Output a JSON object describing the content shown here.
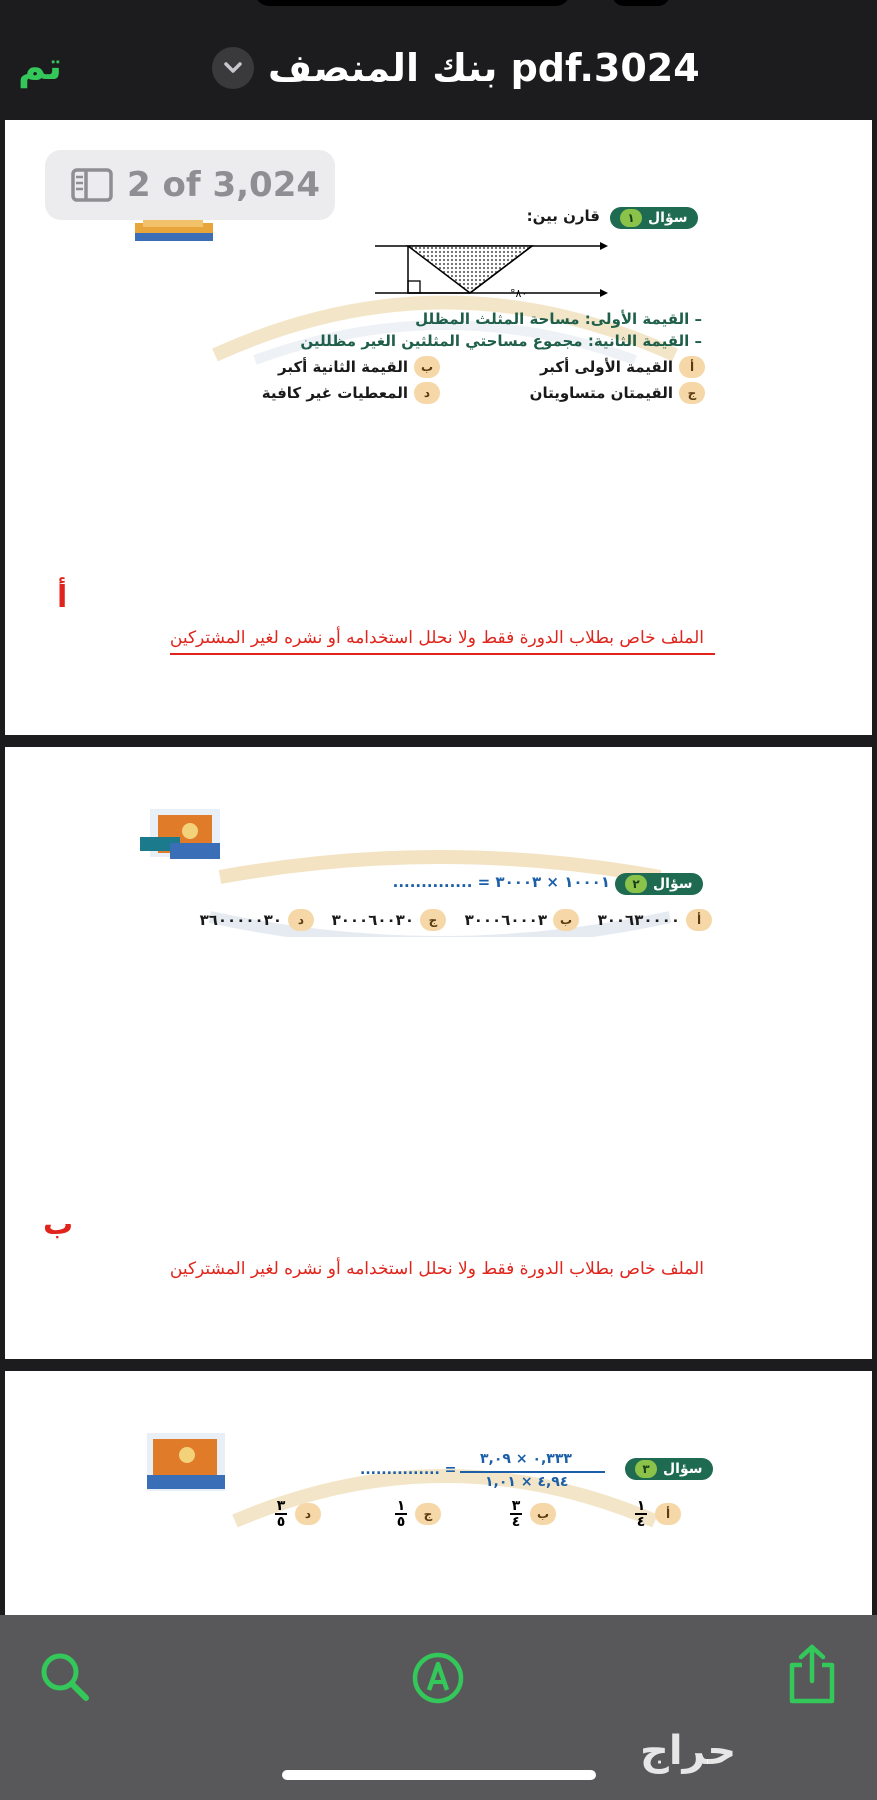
{
  "header": {
    "done_label": "تم",
    "title": "بنك المنصف pdf.3024"
  },
  "page_counter": "2 of 3,024",
  "pages": [
    {
      "question_label": "سؤال",
      "question_number": "١",
      "prompt": "قارن بين:",
      "angle_label": "٨٠°",
      "value1": "– القيمة الأولى: مساحة المثلث المظلل",
      "value2": "– القيمة الثانية: مجموع مساحتي المثلثين الغير مظللين",
      "options": [
        {
          "letter": "أ",
          "text": "القيمة الأولى أكبر"
        },
        {
          "letter": "ب",
          "text": "القيمة الثانية أكبر"
        },
        {
          "letter": "ج",
          "text": "القيمتان متساويتان"
        },
        {
          "letter": "د",
          "text": "المعطيات غير كافية"
        }
      ],
      "answer": "أ",
      "notice": "الملف خاص بطلاب الدورة فقط ولا نحلل استخدامه أو نشره لغير المشتركين"
    },
    {
      "question_label": "سؤال",
      "question_number": "٢",
      "equation": "١٠٠٠١ × ٣٠٠٠٣ = ..............",
      "options": [
        {
          "letter": "أ",
          "text": "٣٠٠٦٣٠٠٠٠"
        },
        {
          "letter": "ب",
          "text": "٣٠٠٠٦٠٠٠٣"
        },
        {
          "letter": "ج",
          "text": "٣٠٠٠٦٠٠٣٠"
        },
        {
          "letter": "د",
          "text": "٣٦٠٠٠٠٠٣٠"
        }
      ],
      "answer": "ب",
      "notice": "الملف خاص بطلاب الدورة فقط ولا نحلل استخدامه أو نشره لغير المشتركين"
    },
    {
      "question_label": "سؤال",
      "question_number": "٣",
      "numerator": "٠,٣٣٣ × ٣,٠٩",
      "denominator": "٤,٩٤ × ١,٠١",
      "blank": "= ...............",
      "options": [
        {
          "letter": "أ",
          "num": "١",
          "den": "٤"
        },
        {
          "letter": "ب",
          "num": "٣",
          "den": "٤"
        },
        {
          "letter": "ج",
          "num": "١",
          "den": "٥"
        },
        {
          "letter": "د",
          "num": "٣",
          "den": "٥"
        }
      ]
    }
  ],
  "toolbar": {
    "search_icon": "search-icon",
    "markup_icon": "markup-pen-icon",
    "share_icon": "share-icon"
  },
  "watermark_text": "حراج",
  "colors": {
    "accent": "#34c759",
    "answer_red": "#e0241b",
    "badge_green": "#1f6b52"
  }
}
